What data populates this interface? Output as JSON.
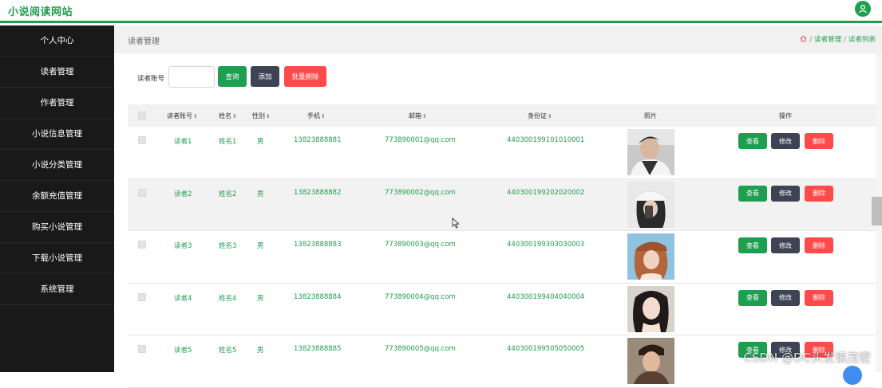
{
  "app": {
    "brand": "小说阅读网站"
  },
  "sidebar": {
    "items": [
      {
        "label": "个人中心"
      },
      {
        "label": "读者管理"
      },
      {
        "label": "作者管理"
      },
      {
        "label": "小说信息管理"
      },
      {
        "label": "小说分类管理"
      },
      {
        "label": "余额充值管理"
      },
      {
        "label": "购买小说管理"
      },
      {
        "label": "下载小说管理"
      },
      {
        "label": "系统管理"
      }
    ]
  },
  "header": {
    "title": "读者管理",
    "breadcrumb": [
      "读者管理",
      "读者列表"
    ]
  },
  "search": {
    "label": "读者账号",
    "value": "",
    "placeholder": "",
    "search_button": "查询",
    "add_button": "添加",
    "batch_delete_button": "批量删除"
  },
  "table": {
    "columns": [
      "读者账号",
      "姓名",
      "性别",
      "手机",
      "邮箱",
      "身份证",
      "照片",
      "操作"
    ],
    "rows": [
      {
        "account": "读者1",
        "name": "姓名1",
        "gender": "男",
        "phone": "13823888881",
        "email": "773890001@qq.com",
        "id_card": "440300199101010001"
      },
      {
        "account": "读者2",
        "name": "姓名2",
        "gender": "男",
        "phone": "13823888882",
        "email": "773890002@qq.com",
        "id_card": "440300199202020002"
      },
      {
        "account": "读者3",
        "name": "姓名3",
        "gender": "男",
        "phone": "13823888883",
        "email": "773890003@qq.com",
        "id_card": "440300199303030003"
      },
      {
        "account": "读者4",
        "name": "姓名4",
        "gender": "男",
        "phone": "13823888884",
        "email": "773890004@qq.com",
        "id_card": "440300199404040004"
      },
      {
        "account": "读者5",
        "name": "姓名5",
        "gender": "男",
        "phone": "13823888885",
        "email": "773890005@qq.com",
        "id_card": "440300199505050005"
      }
    ],
    "actions": {
      "view": "查看",
      "edit": "修改",
      "delete": "删除"
    }
  },
  "watermark": "CSDN @DC头发很茂密",
  "colors": {
    "accent": "#1e9e4f",
    "dark_button": "#3f4455",
    "danger": "#ff4a4a",
    "sidebar": "#191919"
  },
  "icons": [
    "user-icon",
    "home-icon",
    "sort-icon",
    "mouse-cursor-icon"
  ]
}
